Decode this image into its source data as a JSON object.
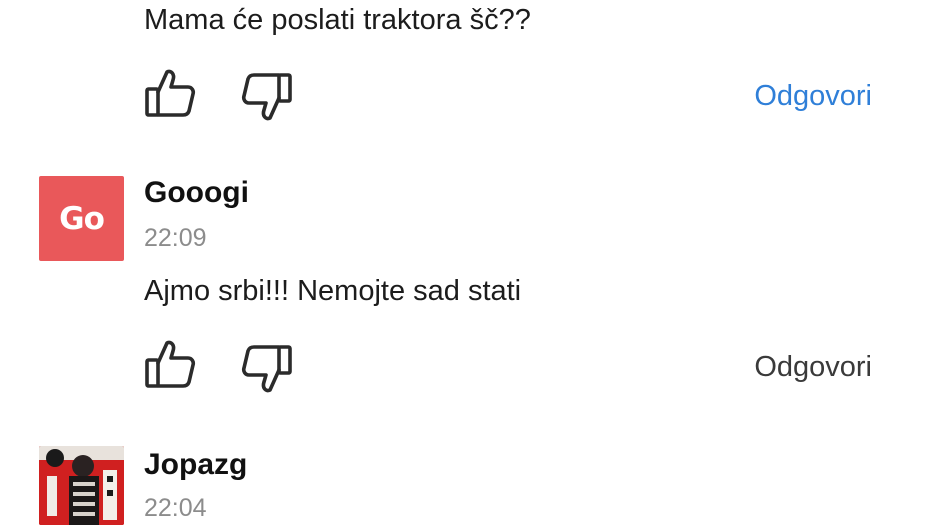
{
  "colors": {
    "reply_active": "#2f7fd8",
    "reply_default": "#3a3a3a",
    "avatar_gooogi": "#e9585a",
    "timestamp": "#8c8c8c"
  },
  "comments": [
    {
      "text": "Mama će poslati traktora šč??",
      "like_icon": "thumbs-up-icon",
      "dislike_icon": "thumbs-down-icon",
      "reply_label": "Odgovori"
    },
    {
      "username": "Gooogi",
      "avatar_initials": "Go",
      "time": "22:09",
      "text": "Ajmo srbi!!! Nemojte sad stati",
      "like_icon": "thumbs-up-icon",
      "dislike_icon": "thumbs-down-icon",
      "reply_label": "Odgovori"
    },
    {
      "username": "Jopazg",
      "avatar_icon": "user-photo-avatar",
      "time": "22:04"
    }
  ]
}
